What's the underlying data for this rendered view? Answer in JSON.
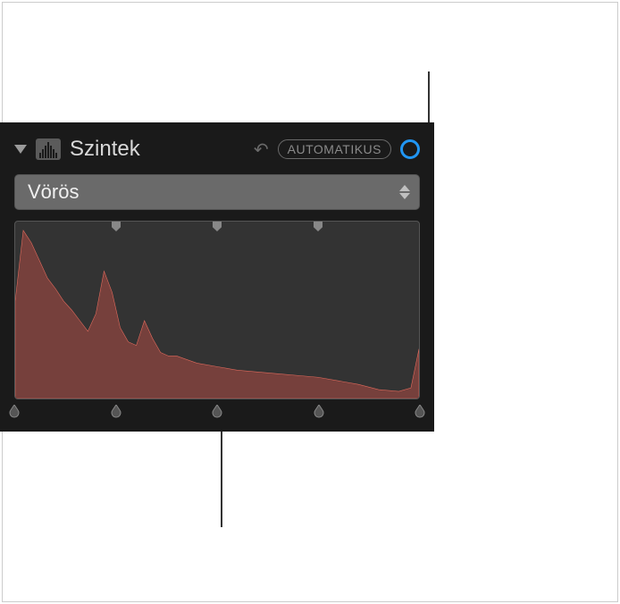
{
  "panel": {
    "title": "Szintek",
    "auto_label": "AUTOMATIKUS",
    "channel_selected": "Vörös"
  },
  "icons": {
    "disclosure": "disclosure-triangle",
    "levels": "levels-icon",
    "undo": "undo-icon",
    "enable": "enable-circle",
    "stepper": "stepper-icon"
  },
  "histogram": {
    "top_handles_pct": [
      25,
      50,
      75
    ],
    "bottom_handles_pct": [
      0,
      25,
      50,
      75,
      100
    ]
  },
  "chart_data": {
    "type": "area",
    "title": "",
    "xlabel": "",
    "ylabel": "",
    "xlim": [
      0,
      100
    ],
    "ylim": [
      0,
      100
    ],
    "series": [
      {
        "name": "Vörös",
        "color": "#d9534f",
        "x": [
          0,
          2,
          4,
          6,
          8,
          10,
          12,
          14,
          16,
          18,
          20,
          22,
          24,
          26,
          28,
          30,
          32,
          34,
          36,
          38,
          40,
          45,
          50,
          55,
          60,
          65,
          70,
          75,
          80,
          85,
          90,
          95,
          98,
          100
        ],
        "y": [
          55,
          95,
          88,
          78,
          68,
          62,
          55,
          50,
          44,
          38,
          48,
          72,
          60,
          40,
          32,
          30,
          44,
          34,
          26,
          24,
          24,
          20,
          18,
          16,
          15,
          14,
          13,
          12,
          10,
          8,
          5,
          4,
          6,
          28
        ]
      }
    ]
  }
}
